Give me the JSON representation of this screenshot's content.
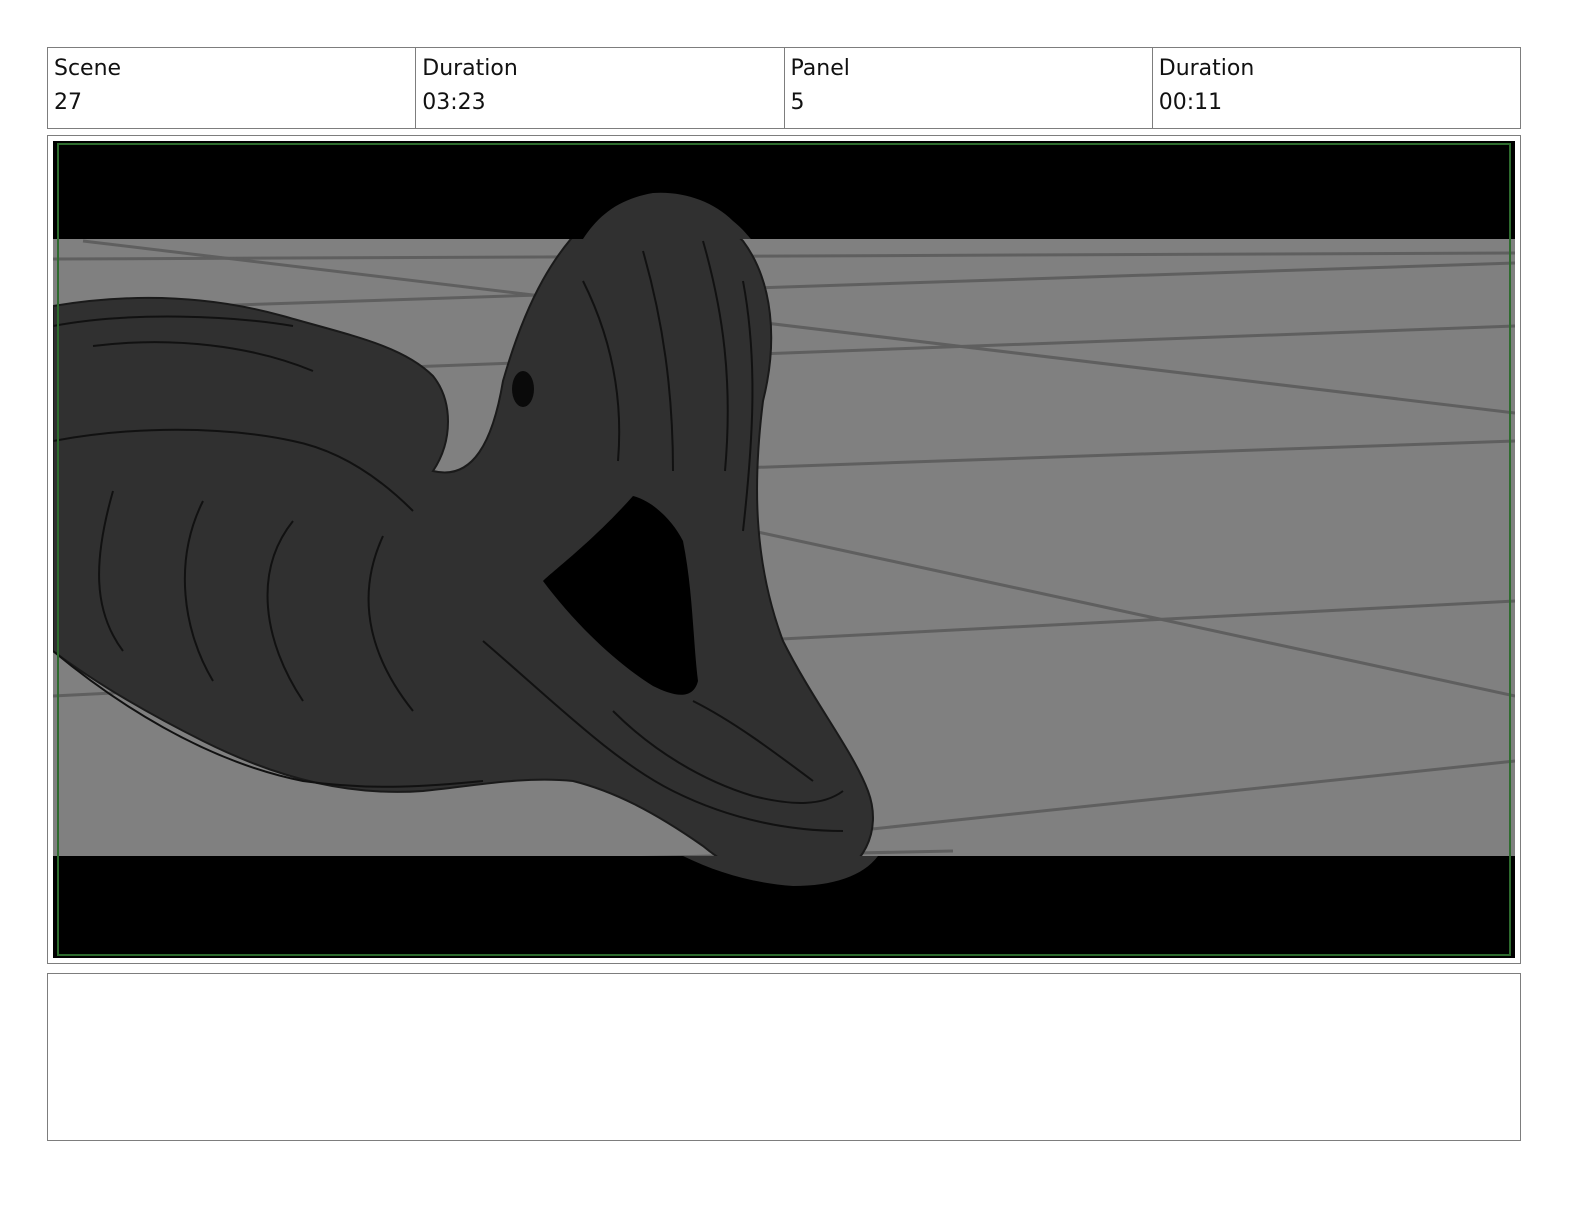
{
  "header": {
    "scene_label": "Scene",
    "scene_value": "27",
    "scene_duration_label": "Duration",
    "scene_duration_value": "03:23",
    "panel_label": "Panel",
    "panel_value": "5",
    "panel_duration_label": "Duration",
    "panel_duration_value": "00:11"
  },
  "notes": {
    "text": ""
  },
  "colors": {
    "letterbox": "#000000",
    "floor": "#808080",
    "grid_lines": "#5f5f5f",
    "creature": "#303030",
    "safe_frame": "#2e6b2e",
    "border": "#7d7d7d"
  }
}
